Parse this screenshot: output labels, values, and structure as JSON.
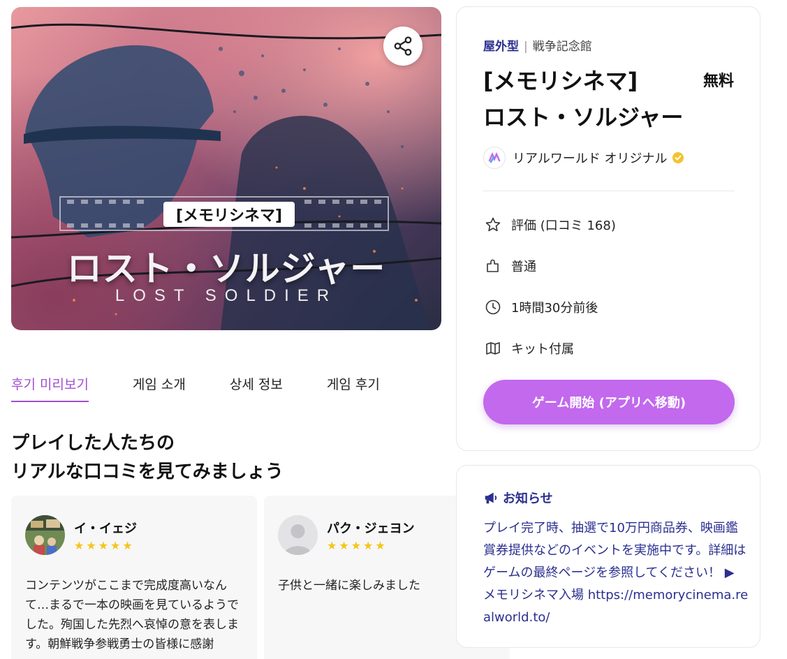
{
  "hero": {
    "badge": "[メモリシネマ]",
    "title": "ロスト・ソルジャー",
    "subtitle": "LOST SOLDIER",
    "share_icon": "share-icon"
  },
  "tabs": [
    {
      "label": "후기 미리보기",
      "active": true
    },
    {
      "label": "게임 소개",
      "active": false
    },
    {
      "label": "상세 정보",
      "active": false
    },
    {
      "label": "게임 후기",
      "active": false
    }
  ],
  "reviews_section": {
    "heading_line1": "プレイした人たちの",
    "heading_line2": "リアルな口コミを見てみましょう"
  },
  "reviews": [
    {
      "name": "イ・イェジ",
      "stars": "★★★★★",
      "rating": 5,
      "text": "コンテンツがここまで完成度高いなんて…まるで一本の映画を見ているようでした。殉国した先烈へ哀悼の意を表します。朝鮮戦争参戦勇士の皆様に感謝",
      "avatar": "photo-avatar"
    },
    {
      "name": "パク・ジェヨン",
      "stars": "★★★★★",
      "rating": 5,
      "text": "子供と一緒に楽しみました",
      "avatar": "default-avatar"
    }
  ],
  "info": {
    "type": "屋外型",
    "separator": "|",
    "category": "戦争記念館",
    "title_line1": "[メモリシネマ]",
    "title_line2": "ロスト・ソルジャー",
    "price": "無料",
    "creator": "リアルワールド オリジナル",
    "rows": [
      {
        "icon": "star-icon",
        "label": "評価 (口コミ 168)"
      },
      {
        "icon": "puzzle-icon",
        "label": "普通"
      },
      {
        "icon": "clock-icon",
        "label": "1時間30分前後"
      },
      {
        "icon": "map-icon",
        "label": "キット付属"
      }
    ],
    "start_button": "ゲーム開始 (アプリへ移動)"
  },
  "notice": {
    "title": "お知らせ",
    "icon": "megaphone-icon",
    "body": "プレイ完了時、抽選で10万円商品券、映画鑑賞券提供などのイベントを実施中です。詳細はゲームの最終ページを参照してください！ ▶ メモリシネマ入場 https://memorycinema.realworld.to/"
  },
  "colors": {
    "accent": "#c269ee",
    "tab_active": "#a14fd0",
    "notice_text": "#2b2f8f",
    "star": "#f5c518"
  }
}
